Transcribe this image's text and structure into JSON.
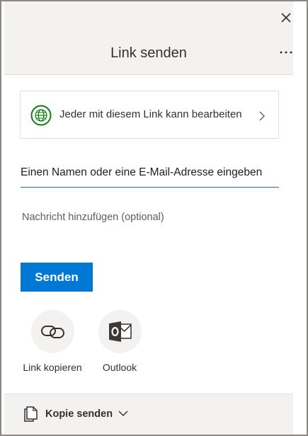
{
  "header": {
    "title": "Link senden",
    "close_icon": "close-icon",
    "more_icon": "more-options-icon"
  },
  "permission": {
    "text": "Jeder mit diesem Link kann bearbeiten",
    "icon": "globe-icon",
    "chevron_icon": "chevron-right-icon"
  },
  "recipient": {
    "placeholder": "Einen Namen oder eine E-Mail-Adresse eingeben",
    "value": ""
  },
  "message": {
    "placeholder": "Nachricht hinzufügen (optional)",
    "value": ""
  },
  "send_button": {
    "label": "Senden"
  },
  "share_options": [
    {
      "label": "Link kopieren",
      "icon": "link-icon"
    },
    {
      "label": "Outlook",
      "icon": "outlook-icon"
    }
  ],
  "footer": {
    "label": "Kopie senden",
    "icon": "copy-document-icon",
    "dropdown_icon": "chevron-down-icon"
  },
  "colors": {
    "accent": "#0078d4",
    "header_bg": "#f3f2f1",
    "globe_green": "#107c10",
    "outlook_dark": "#3b3a39"
  }
}
